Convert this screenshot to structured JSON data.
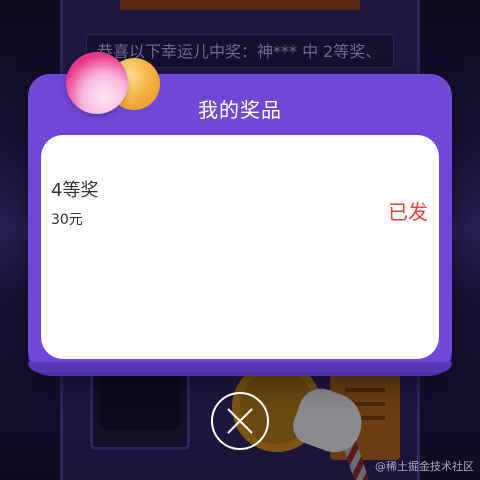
{
  "background": {
    "marquee_text": "恭喜以下幸运儿中奖：神*** 中 2等奖、"
  },
  "modal": {
    "title": "我的奖品",
    "prize": {
      "name": "4等奖",
      "value": "30元",
      "status": "已发"
    }
  },
  "watermark": "@稀土掘金技术社区",
  "icons": {
    "close": "close-icon",
    "balloons": "balloons-decoration"
  },
  "colors": {
    "modal_purple": "#7048d8",
    "status_red": "#e0453a",
    "text_dark": "#333333"
  }
}
